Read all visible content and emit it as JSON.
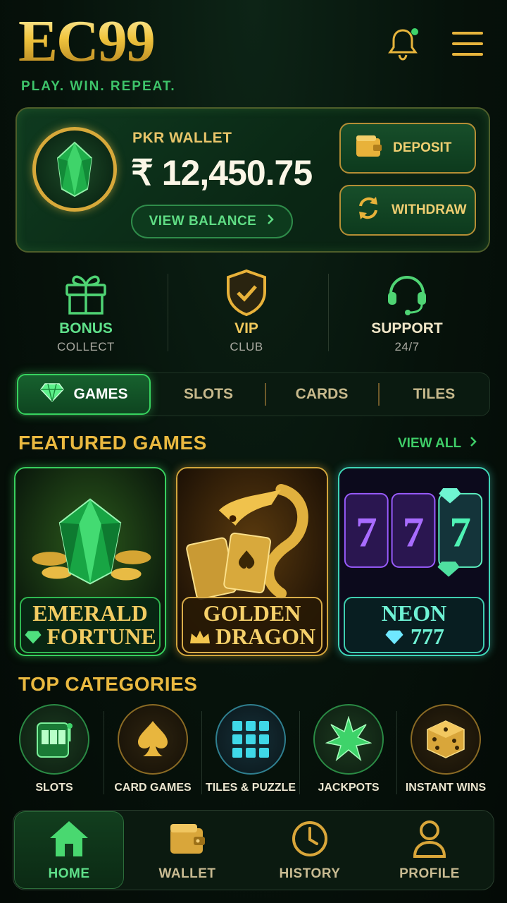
{
  "header": {
    "logo": "EC99",
    "tagline": "PLAY. WIN. REPEAT.",
    "bell_icon": "bell-icon",
    "menu_icon": "hamburger-menu-icon"
  },
  "wallet": {
    "label": "PKR WALLET",
    "amount": "₹ 12,450.75",
    "view_balance": "VIEW BALANCE",
    "deposit": "DEPOSIT",
    "withdraw": "WITHDRAW"
  },
  "quick_actions": [
    {
      "title": "BONUS",
      "sub": "COLLECT",
      "icon": "gift-icon"
    },
    {
      "title": "VIP",
      "sub": "CLUB",
      "icon": "shield-check-icon"
    },
    {
      "title": "SUPPORT",
      "sub": "24/7",
      "icon": "headset-icon"
    }
  ],
  "tabs": [
    {
      "label": "GAMES",
      "active": true
    },
    {
      "label": "SLOTS",
      "active": false
    },
    {
      "label": "CARDS",
      "active": false
    },
    {
      "label": "TILES",
      "active": false
    }
  ],
  "featured": {
    "heading": "FEATURED GAMES",
    "view_all": "VIEW ALL",
    "games": [
      {
        "line1": "EMERALD",
        "line2": "FORTUNE"
      },
      {
        "line1": "GOLDEN",
        "line2": "DRAGON"
      },
      {
        "line1": "NEON",
        "line2": "777"
      }
    ]
  },
  "categories": {
    "heading": "TOP CATEGORIES",
    "items": [
      {
        "label": "SLOTS",
        "icon": "slot-machine-icon"
      },
      {
        "label": "CARD GAMES",
        "icon": "spade-icon"
      },
      {
        "label": "TILES & PUZZLE",
        "icon": "tiles-grid-icon"
      },
      {
        "label": "JACKPOTS",
        "icon": "star-burst-icon"
      },
      {
        "label": "INSTANT WINS",
        "icon": "dice-icon"
      }
    ]
  },
  "nav": [
    {
      "label": "HOME",
      "icon": "home-icon",
      "active": true
    },
    {
      "label": "WALLET",
      "icon": "wallet-icon",
      "active": false
    },
    {
      "label": "HISTORY",
      "icon": "clock-icon",
      "active": false
    },
    {
      "label": "PROFILE",
      "icon": "profile-icon",
      "active": false
    }
  ],
  "colors": {
    "accent_green": "#3ec46a",
    "gold": "#eab940",
    "background": "#06120b"
  }
}
